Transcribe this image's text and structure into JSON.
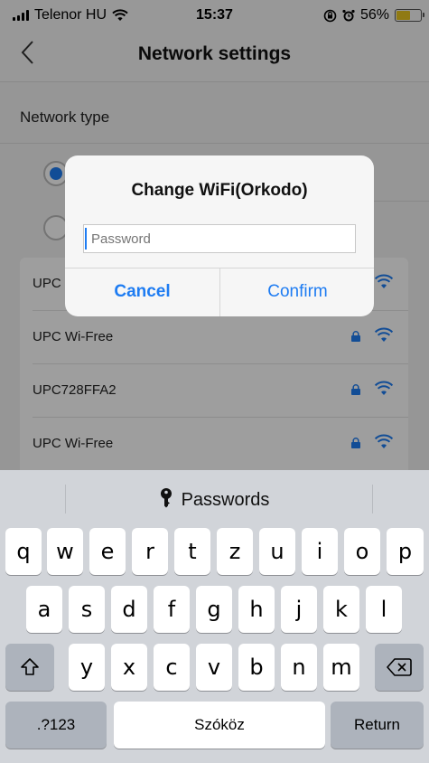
{
  "status_bar": {
    "carrier": "Telenor HU",
    "time": "15:37",
    "battery_percent": "56%",
    "battery_color": "#e8c520"
  },
  "nav": {
    "back_icon": "chevron-left-icon",
    "title": "Network settings"
  },
  "network_type": {
    "label": "Network type"
  },
  "wifi_list": [
    {
      "ssid": "UPC",
      "locked": false
    },
    {
      "ssid": "UPC Wi-Free",
      "locked": true
    },
    {
      "ssid": "UPC728FFA2",
      "locked": true
    },
    {
      "ssid": "UPC Wi-Free",
      "locked": true
    }
  ],
  "dialog": {
    "title": "Change WiFi(Orkodo)",
    "password_placeholder": "Password",
    "password_value": "",
    "cancel_label": "Cancel",
    "confirm_label": "Confirm"
  },
  "keyboard": {
    "quicktype_label": "Passwords",
    "row1": [
      "q",
      "w",
      "e",
      "r",
      "t",
      "z",
      "u",
      "i",
      "o",
      "p"
    ],
    "row2": [
      "a",
      "s",
      "d",
      "f",
      "g",
      "h",
      "j",
      "k",
      "l"
    ],
    "row3": [
      "y",
      "x",
      "c",
      "v",
      "b",
      "n",
      "m"
    ],
    "shift_icon": "shift-icon",
    "delete_icon": "backspace-icon",
    "numbers_label": ".?123",
    "space_label": "Szóköz",
    "return_label": "Return"
  },
  "colors": {
    "accent": "#1e7cf2",
    "keyboard_bg": "#d1d4d9"
  }
}
